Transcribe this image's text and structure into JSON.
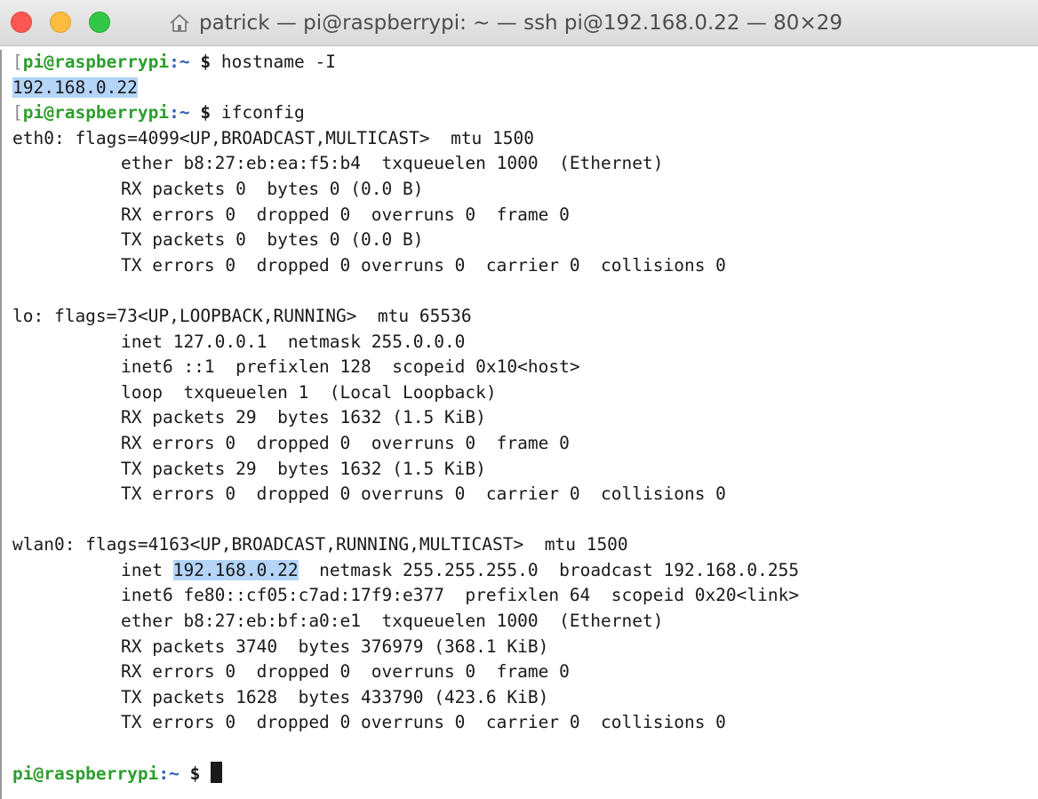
{
  "window": {
    "title": "patrick — pi@raspberrypi: ~ — ssh pi@192.168.0.22 — 80×29",
    "title_icon": "home-icon",
    "colors": {
      "close": "#fc5753",
      "minimize": "#fdbc40",
      "zoom": "#33c748",
      "prompt_user": "#2e9e2e",
      "prompt_path": "#2d5fb5",
      "selection": "#b4d4f8"
    }
  },
  "prompt": {
    "user_host": "pi@raspberrypi",
    "path": ":~",
    "symbol": "$"
  },
  "commands": {
    "first": "hostname -I",
    "second": "ifconfig"
  },
  "output": {
    "hostname": "192.168.0.22",
    "eth0": {
      "header": "eth0: flags=4099<UP,BROADCAST,MULTICAST>  mtu 1500",
      "lines": [
        "ether b8:27:eb:ea:f5:b4  txqueuelen 1000  (Ethernet)",
        "RX packets 0  bytes 0 (0.0 B)",
        "RX errors 0  dropped 0  overruns 0  frame 0",
        "TX packets 0  bytes 0 (0.0 B)",
        "TX errors 0  dropped 0 overruns 0  carrier 0  collisions 0"
      ]
    },
    "lo": {
      "header": "lo: flags=73<UP,LOOPBACK,RUNNING>  mtu 65536",
      "lines": [
        "inet 127.0.0.1  netmask 255.0.0.0",
        "inet6 ::1  prefixlen 128  scopeid 0x10<host>",
        "loop  txqueuelen 1  (Local Loopback)",
        "RX packets 29  bytes 1632 (1.5 KiB)",
        "RX errors 0  dropped 0  overruns 0  frame 0",
        "TX packets 29  bytes 1632 (1.5 KiB)",
        "TX errors 0  dropped 0 overruns 0  carrier 0  collisions 0"
      ]
    },
    "wlan0": {
      "header": "wlan0: flags=4163<UP,BROADCAST,RUNNING,MULTICAST>  mtu 1500",
      "inet_label": "inet ",
      "inet_ip": "192.168.0.22",
      "inet_rest": "  netmask 255.255.255.0  broadcast 192.168.0.255",
      "lines": [
        "inet6 fe80::cf05:c7ad:17f9:e377  prefixlen 64  scopeid 0x20<link>",
        "ether b8:27:eb:bf:a0:e1  txqueuelen 1000  (Ethernet)",
        "RX packets 3740  bytes 376979 (368.1 KiB)",
        "RX errors 0  dropped 0  overruns 0  frame 0",
        "TX packets 1628  bytes 433790 (423.6 KiB)",
        "TX errors 0  dropped 0 overruns 0  carrier 0  collisions 0"
      ]
    }
  }
}
